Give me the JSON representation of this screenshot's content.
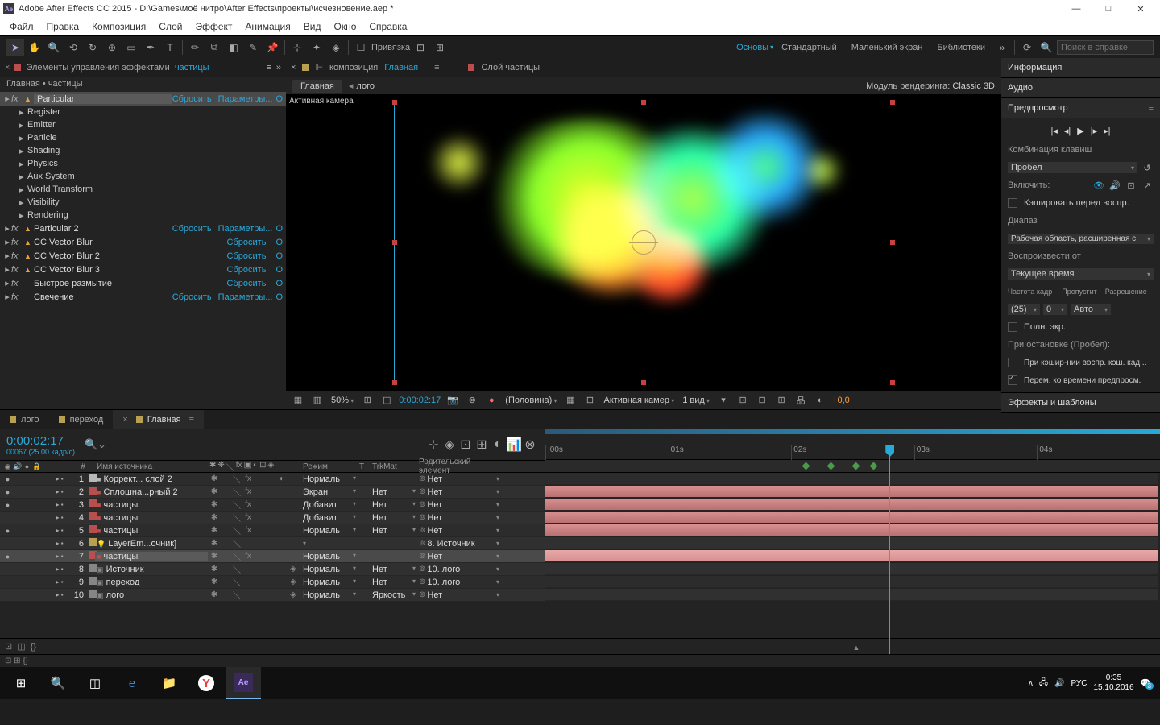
{
  "titlebar": {
    "app": "Adobe After Effects CC 2015",
    "file": "D:\\Games\\моё нитро\\After Effects\\проекты\\исчезновение.aep *"
  },
  "menubar": [
    "Файл",
    "Правка",
    "Композиция",
    "Слой",
    "Эффект",
    "Анимация",
    "Вид",
    "Окно",
    "Справка"
  ],
  "toolbar": {
    "snap": "Привязка",
    "ws": [
      "Основы",
      "Стандартный",
      "Маленький экран",
      "Библиотеки"
    ],
    "search_ph": "Поиск в справке"
  },
  "left": {
    "tab": "Элементы управления эффектами",
    "tab_layer": "частицы",
    "crumb": "Главная • частицы",
    "fx": [
      {
        "name": "Particular",
        "boxed": true,
        "warn": true,
        "reset": "Сбросить",
        "opts": "Параметры...",
        "о": "О",
        "subs": [
          "Register",
          "Emitter",
          "Particle",
          "Shading",
          "Physics",
          "Aux System",
          "World Transform",
          "Visibility",
          "Rendering"
        ]
      },
      {
        "name": "Particular 2",
        "warn": true,
        "reset": "Сбросить",
        "opts": "Параметры...",
        "о": "О"
      },
      {
        "name": "CC Vector Blur",
        "warn": true,
        "reset": "Сбросить",
        "о": "О"
      },
      {
        "name": "CC Vector Blur 2",
        "warn": true,
        "reset": "Сбросить",
        "о": "О"
      },
      {
        "name": "CC Vector Blur 3",
        "warn": true,
        "reset": "Сбросить",
        "о": "О"
      },
      {
        "name": "Быстрое размытие",
        "reset": "Сбросить",
        "о": "О"
      },
      {
        "name": "Свечение",
        "reset": "Сбросить",
        "opts": "Параметры...",
        "о": "О"
      }
    ]
  },
  "center": {
    "tab_comp": "композиция",
    "tab_comp_name": "Главная",
    "tab_layer": "Слой частицы",
    "crumb_main": "Главная",
    "crumb_logo": "лого",
    "render_label": "Модуль рендеринга:",
    "render_val": "Classic 3D",
    "cam": "Активная камера",
    "footer": {
      "zoom": "50%",
      "tc": "0:00:02:17",
      "res": "(Половина)",
      "cam": "Активная камер",
      "views": "1 вид",
      "offset": "+0,0"
    }
  },
  "right": {
    "info": "Информация",
    "audio": "Аудио",
    "preview": "Предпросмотр",
    "shortcut_lbl": "Комбинация клавиш",
    "shortcut": "Пробел",
    "include": "Включить:",
    "cache": "Кэшировать перед воспр.",
    "range_lbl": "Диапаз",
    "range": "Рабочая область, расширенная с",
    "playfrom_lbl": "Воспроизвести от",
    "playfrom": "Текущее время",
    "fps_lbl": "Частота кадр",
    "skip_lbl": "Пропустит",
    "res_lbl": "Разрешение",
    "fps": "(25)",
    "skip": "0",
    "res": "Авто",
    "full": "Полн. экр.",
    "onstop": "При остановке (Пробел):",
    "onstop1": "При кэшир-нии воспр. кэш. кад...",
    "onstop2": "Перем. ко времени предпросм.",
    "fxpanel": "Эффекты и шаблоны"
  },
  "timeline": {
    "tabs": [
      "лого",
      "переход",
      "Главная"
    ],
    "tc": "0:00:02:17",
    "sub": "00067 (25.00 кадр/с)",
    "cols": {
      "name": "Имя источника",
      "mode": "Режим",
      "t": "T",
      "trk": "TrkMat",
      "parent": "Родительский элемент"
    },
    "ruler": [
      ":00s",
      "01s",
      "02s",
      "03s",
      "04s"
    ],
    "rows": [
      {
        "i": 1,
        "c": "#b8b8b8",
        "nm": "Коррект... слой 2",
        "mode": "Нормаль",
        "trk": "",
        "par": "Нет",
        "bar": "",
        "eye": true,
        "adj": true,
        "fx": true
      },
      {
        "i": 2,
        "c": "#b94e4e",
        "nm": "Сплошна...рный 2",
        "mode": "Экран",
        "trk": "Нет",
        "par": "Нет",
        "bar": "pink",
        "eye": true,
        "fx": true
      },
      {
        "i": 3,
        "c": "#b94e4e",
        "nm": "частицы",
        "mode": "Добавит",
        "trk": "Нет",
        "par": "Нет",
        "bar": "pink",
        "eye": true,
        "fx": true
      },
      {
        "i": 4,
        "c": "#b94e4e",
        "nm": "частицы",
        "mode": "Добавит",
        "trk": "Нет",
        "par": "Нет",
        "bar": "pink",
        "fx": true
      },
      {
        "i": 5,
        "c": "#b94e4e",
        "nm": "частицы",
        "mode": "Нормаль",
        "trk": "Нет",
        "par": "Нет",
        "bar": "pink",
        "eye": true,
        "fx": true
      },
      {
        "i": 6,
        "c": "#b8a050",
        "nm": "LayerEm...очник]",
        "mode": "",
        "trk": "",
        "par": "8. Источник",
        "bar": "",
        "light": true
      },
      {
        "i": 7,
        "c": "#b94e4e",
        "nm": "частицы",
        "mode": "Нормаль",
        "trk": "",
        "par": "Нет",
        "bar": "pinksel",
        "sel": true,
        "boxed": true,
        "eye": true,
        "fx": true
      },
      {
        "i": 8,
        "c": "#868686",
        "nm": "Источник",
        "mode": "Нормаль",
        "trk": "Нет",
        "par": "10. лого",
        "bar": "",
        "comp": true,
        "c3d": true
      },
      {
        "i": 9,
        "c": "#868686",
        "nm": "переход",
        "mode": "Нормаль",
        "trk": "Нет",
        "par": "10. лого",
        "bar": "",
        "comp": true,
        "c3d": true
      },
      {
        "i": 10,
        "c": "#868686",
        "nm": "лого",
        "mode": "Нормаль",
        "trk": "Яркость",
        "par": "Нет",
        "bar": "",
        "comp": true,
        "c3d": true
      }
    ],
    "playhead_pct": 56
  },
  "taskbar": {
    "lang": "РУС",
    "time": "0:35",
    "date": "15.10.2016",
    "badge": "3"
  }
}
